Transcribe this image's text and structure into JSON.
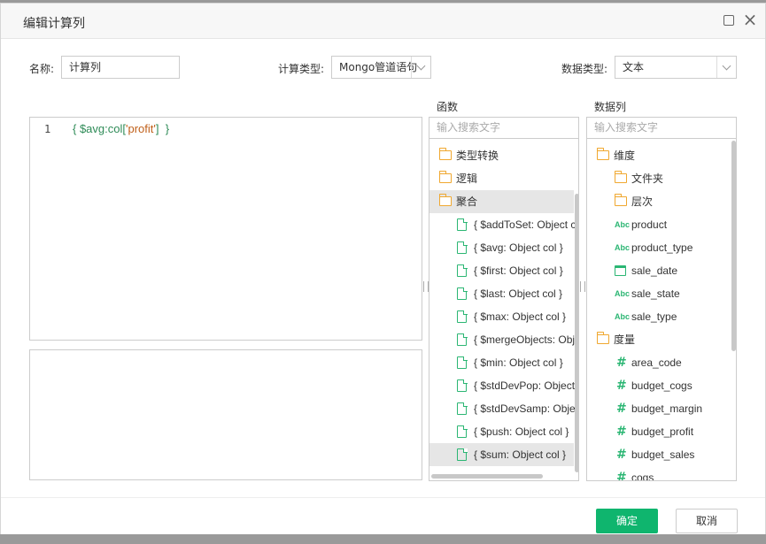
{
  "dialog": {
    "title": "编辑计算列"
  },
  "form": {
    "name_label": "名称:",
    "name_value": "计算列",
    "calc_type_label": "计算类型:",
    "calc_type_value": "Mongo管道语句",
    "data_type_label": "数据类型:",
    "data_type_value": "文本"
  },
  "editor": {
    "line_number": "1",
    "code_open": "{ $avg:col[",
    "code_string": "'profit'",
    "code_close": "]  }"
  },
  "functions": {
    "title": "函数",
    "search_placeholder": "输入搜索文字",
    "items": [
      {
        "label": "类型转换",
        "type": "folder"
      },
      {
        "label": "逻辑",
        "type": "folder"
      },
      {
        "label": "聚合",
        "type": "folder",
        "selected": true
      },
      {
        "label": "{ $addToSet: Object col }",
        "type": "func"
      },
      {
        "label": "{ $avg: Object col }",
        "type": "func"
      },
      {
        "label": "{ $first: Object col }",
        "type": "func"
      },
      {
        "label": "{ $last: Object col }",
        "type": "func"
      },
      {
        "label": "{ $max: Object col }",
        "type": "func"
      },
      {
        "label": "{ $mergeObjects: Object col }",
        "type": "func"
      },
      {
        "label": "{ $min: Object col }",
        "type": "func"
      },
      {
        "label": "{ $stdDevPop: Object col }",
        "type": "func"
      },
      {
        "label": "{ $stdDevSamp: Object col }",
        "type": "func"
      },
      {
        "label": "{ $push: Object col }",
        "type": "func"
      },
      {
        "label": "{ $sum: Object col }",
        "type": "func",
        "hovered": true
      }
    ]
  },
  "columns": {
    "title": "数据列",
    "search_placeholder": "输入搜索文字",
    "items": [
      {
        "label": "维度",
        "type": "folder",
        "level": 0
      },
      {
        "label": "文件夹",
        "type": "folder",
        "level": 1
      },
      {
        "label": "层次",
        "type": "hier-folder",
        "level": 1
      },
      {
        "label": "product",
        "type": "text",
        "level": 1
      },
      {
        "label": "product_type",
        "type": "text",
        "level": 1
      },
      {
        "label": "sale_date",
        "type": "date",
        "level": 1
      },
      {
        "label": "sale_state",
        "type": "text",
        "level": 1
      },
      {
        "label": "sale_type",
        "type": "text",
        "level": 1
      },
      {
        "label": "度量",
        "type": "folder",
        "level": 0
      },
      {
        "label": "area_code",
        "type": "number",
        "level": 1
      },
      {
        "label": "budget_cogs",
        "type": "number",
        "level": 1
      },
      {
        "label": "budget_margin",
        "type": "number",
        "level": 1
      },
      {
        "label": "budget_profit",
        "type": "number",
        "level": 1
      },
      {
        "label": "budget_sales",
        "type": "number",
        "level": 1
      },
      {
        "label": "cogs",
        "type": "number",
        "level": 1
      }
    ]
  },
  "icons": {
    "text_type": "Abc",
    "number_type": "#"
  },
  "footer": {
    "ok_label": "确定",
    "cancel_label": "取消"
  },
  "colors": {
    "accent": "#0fb56e",
    "folder": "#f0a830",
    "icon_green": "#2bb673"
  }
}
